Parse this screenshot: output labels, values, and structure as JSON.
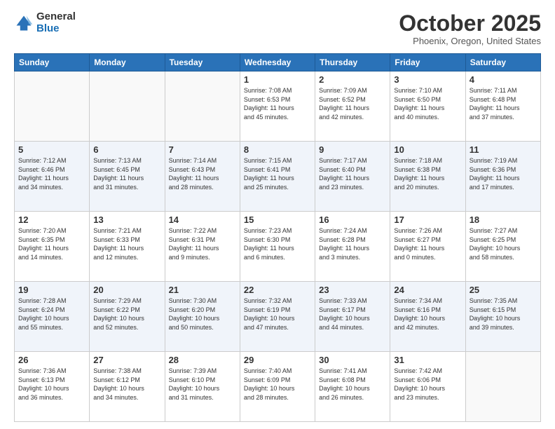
{
  "header": {
    "logo_general": "General",
    "logo_blue": "Blue",
    "month_title": "October 2025",
    "location": "Phoenix, Oregon, United States"
  },
  "days_of_week": [
    "Sunday",
    "Monday",
    "Tuesday",
    "Wednesday",
    "Thursday",
    "Friday",
    "Saturday"
  ],
  "weeks": [
    [
      {
        "day": "",
        "info": ""
      },
      {
        "day": "",
        "info": ""
      },
      {
        "day": "",
        "info": ""
      },
      {
        "day": "1",
        "info": "Sunrise: 7:08 AM\nSunset: 6:53 PM\nDaylight: 11 hours\nand 45 minutes."
      },
      {
        "day": "2",
        "info": "Sunrise: 7:09 AM\nSunset: 6:52 PM\nDaylight: 11 hours\nand 42 minutes."
      },
      {
        "day": "3",
        "info": "Sunrise: 7:10 AM\nSunset: 6:50 PM\nDaylight: 11 hours\nand 40 minutes."
      },
      {
        "day": "4",
        "info": "Sunrise: 7:11 AM\nSunset: 6:48 PM\nDaylight: 11 hours\nand 37 minutes."
      }
    ],
    [
      {
        "day": "5",
        "info": "Sunrise: 7:12 AM\nSunset: 6:46 PM\nDaylight: 11 hours\nand 34 minutes."
      },
      {
        "day": "6",
        "info": "Sunrise: 7:13 AM\nSunset: 6:45 PM\nDaylight: 11 hours\nand 31 minutes."
      },
      {
        "day": "7",
        "info": "Sunrise: 7:14 AM\nSunset: 6:43 PM\nDaylight: 11 hours\nand 28 minutes."
      },
      {
        "day": "8",
        "info": "Sunrise: 7:15 AM\nSunset: 6:41 PM\nDaylight: 11 hours\nand 25 minutes."
      },
      {
        "day": "9",
        "info": "Sunrise: 7:17 AM\nSunset: 6:40 PM\nDaylight: 11 hours\nand 23 minutes."
      },
      {
        "day": "10",
        "info": "Sunrise: 7:18 AM\nSunset: 6:38 PM\nDaylight: 11 hours\nand 20 minutes."
      },
      {
        "day": "11",
        "info": "Sunrise: 7:19 AM\nSunset: 6:36 PM\nDaylight: 11 hours\nand 17 minutes."
      }
    ],
    [
      {
        "day": "12",
        "info": "Sunrise: 7:20 AM\nSunset: 6:35 PM\nDaylight: 11 hours\nand 14 minutes."
      },
      {
        "day": "13",
        "info": "Sunrise: 7:21 AM\nSunset: 6:33 PM\nDaylight: 11 hours\nand 12 minutes."
      },
      {
        "day": "14",
        "info": "Sunrise: 7:22 AM\nSunset: 6:31 PM\nDaylight: 11 hours\nand 9 minutes."
      },
      {
        "day": "15",
        "info": "Sunrise: 7:23 AM\nSunset: 6:30 PM\nDaylight: 11 hours\nand 6 minutes."
      },
      {
        "day": "16",
        "info": "Sunrise: 7:24 AM\nSunset: 6:28 PM\nDaylight: 11 hours\nand 3 minutes."
      },
      {
        "day": "17",
        "info": "Sunrise: 7:26 AM\nSunset: 6:27 PM\nDaylight: 11 hours\nand 0 minutes."
      },
      {
        "day": "18",
        "info": "Sunrise: 7:27 AM\nSunset: 6:25 PM\nDaylight: 10 hours\nand 58 minutes."
      }
    ],
    [
      {
        "day": "19",
        "info": "Sunrise: 7:28 AM\nSunset: 6:24 PM\nDaylight: 10 hours\nand 55 minutes."
      },
      {
        "day": "20",
        "info": "Sunrise: 7:29 AM\nSunset: 6:22 PM\nDaylight: 10 hours\nand 52 minutes."
      },
      {
        "day": "21",
        "info": "Sunrise: 7:30 AM\nSunset: 6:20 PM\nDaylight: 10 hours\nand 50 minutes."
      },
      {
        "day": "22",
        "info": "Sunrise: 7:32 AM\nSunset: 6:19 PM\nDaylight: 10 hours\nand 47 minutes."
      },
      {
        "day": "23",
        "info": "Sunrise: 7:33 AM\nSunset: 6:17 PM\nDaylight: 10 hours\nand 44 minutes."
      },
      {
        "day": "24",
        "info": "Sunrise: 7:34 AM\nSunset: 6:16 PM\nDaylight: 10 hours\nand 42 minutes."
      },
      {
        "day": "25",
        "info": "Sunrise: 7:35 AM\nSunset: 6:15 PM\nDaylight: 10 hours\nand 39 minutes."
      }
    ],
    [
      {
        "day": "26",
        "info": "Sunrise: 7:36 AM\nSunset: 6:13 PM\nDaylight: 10 hours\nand 36 minutes."
      },
      {
        "day": "27",
        "info": "Sunrise: 7:38 AM\nSunset: 6:12 PM\nDaylight: 10 hours\nand 34 minutes."
      },
      {
        "day": "28",
        "info": "Sunrise: 7:39 AM\nSunset: 6:10 PM\nDaylight: 10 hours\nand 31 minutes."
      },
      {
        "day": "29",
        "info": "Sunrise: 7:40 AM\nSunset: 6:09 PM\nDaylight: 10 hours\nand 28 minutes."
      },
      {
        "day": "30",
        "info": "Sunrise: 7:41 AM\nSunset: 6:08 PM\nDaylight: 10 hours\nand 26 minutes."
      },
      {
        "day": "31",
        "info": "Sunrise: 7:42 AM\nSunset: 6:06 PM\nDaylight: 10 hours\nand 23 minutes."
      },
      {
        "day": "",
        "info": ""
      }
    ]
  ]
}
